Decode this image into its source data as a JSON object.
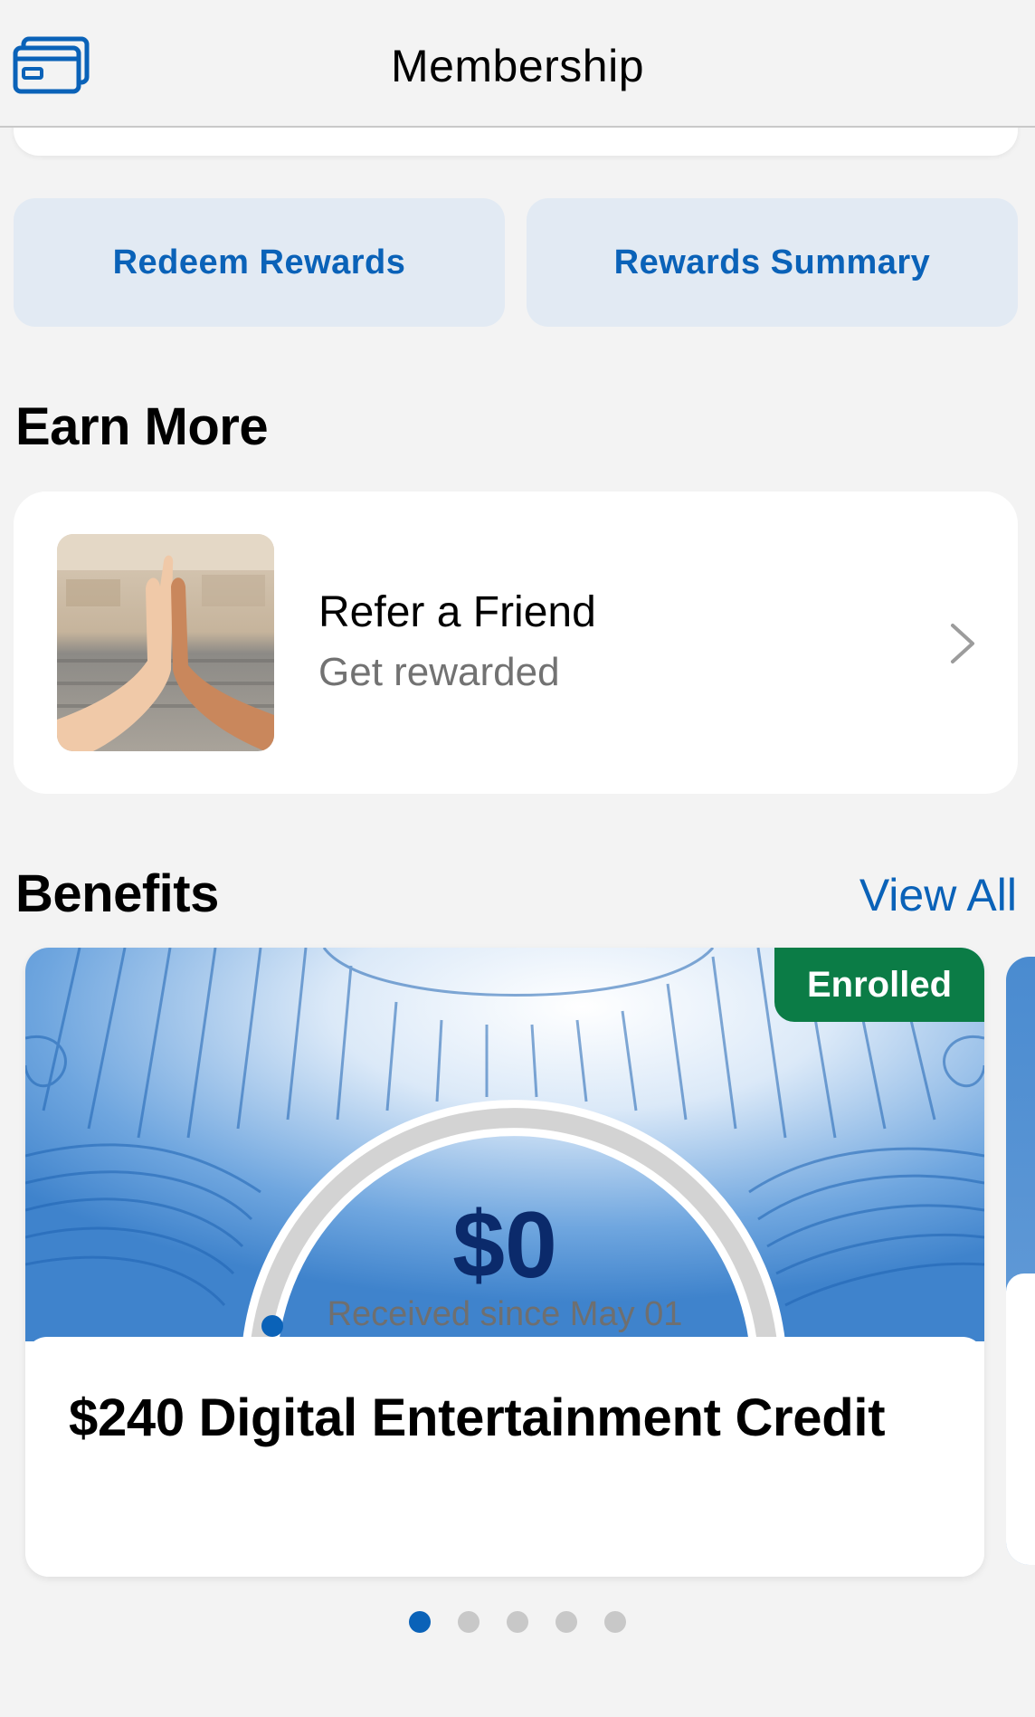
{
  "header": {
    "title": "Membership",
    "icon": "cards-icon"
  },
  "actions": {
    "redeem_label": "Redeem Rewards",
    "summary_label": "Rewards Summary"
  },
  "earn_more": {
    "title": "Earn More",
    "item": {
      "title": "Refer a Friend",
      "subtitle": "Get rewarded",
      "icon": "chevron-right-icon"
    }
  },
  "benefits": {
    "title": "Benefits",
    "view_all_label": "View All",
    "card": {
      "badge": "Enrolled",
      "amount": "$0",
      "received_text": "Received since May 01",
      "progress": 0,
      "title": "$240 Digital Entertainment Credit"
    },
    "pager": {
      "count": 5,
      "active_index": 0
    }
  },
  "colors": {
    "accent": "#0a62b8",
    "badge": "#0b7c46",
    "amount": "#0b2a6b"
  }
}
